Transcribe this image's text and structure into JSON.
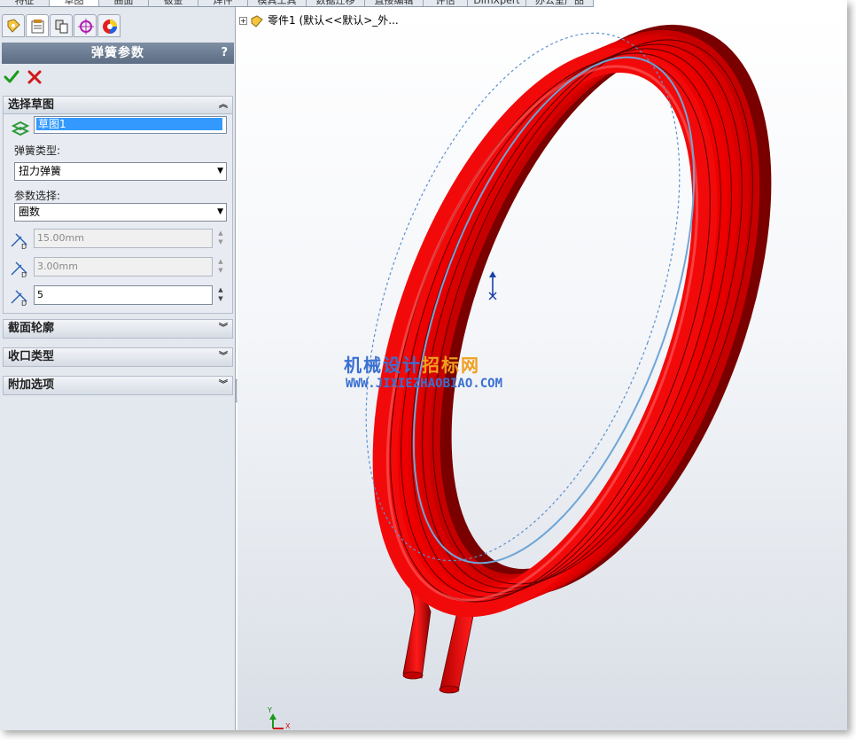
{
  "ribbon": {
    "tabs": [
      "特征",
      "草图",
      "曲面",
      "钣金",
      "焊件",
      "模具工具",
      "数据迁移",
      "直接编辑",
      "评估",
      "DimXpert",
      "办公室产品"
    ]
  },
  "property_manager": {
    "title": "弹簧参数",
    "help": "?",
    "tab_icons": [
      "feature-tree-icon",
      "property-manager-icon",
      "configuration-icon",
      "dimxpert-icon",
      "appearance-icon"
    ],
    "ok_icon": "checkmark-icon",
    "cancel_icon": "cross-icon"
  },
  "select_sketch": {
    "title": "选择草图",
    "sketch_value": "草图1",
    "spring_type_label": "弹簧类型:",
    "spring_type_value": "扭力弹簧",
    "param_choice_label": "参数选择:",
    "param_choice_value": "圈数",
    "params": [
      {
        "value": "15.00mm",
        "enabled": false
      },
      {
        "value": "3.00mm",
        "enabled": false
      },
      {
        "value": "5",
        "enabled": true
      }
    ]
  },
  "sections": {
    "profile": "截面轮廓",
    "end_type": "收口类型",
    "extra": "附加选项"
  },
  "graphics": {
    "tree_label": "零件1  (默认<<默认>_外...",
    "watermark_title_a": "机械设计",
    "watermark_title_b": "招标网",
    "watermark_url": "WWW.JIXIEZHAOBIAO.COM",
    "spring_color": "#e00000",
    "triad_y": "Y",
    "triad_x": "X"
  }
}
